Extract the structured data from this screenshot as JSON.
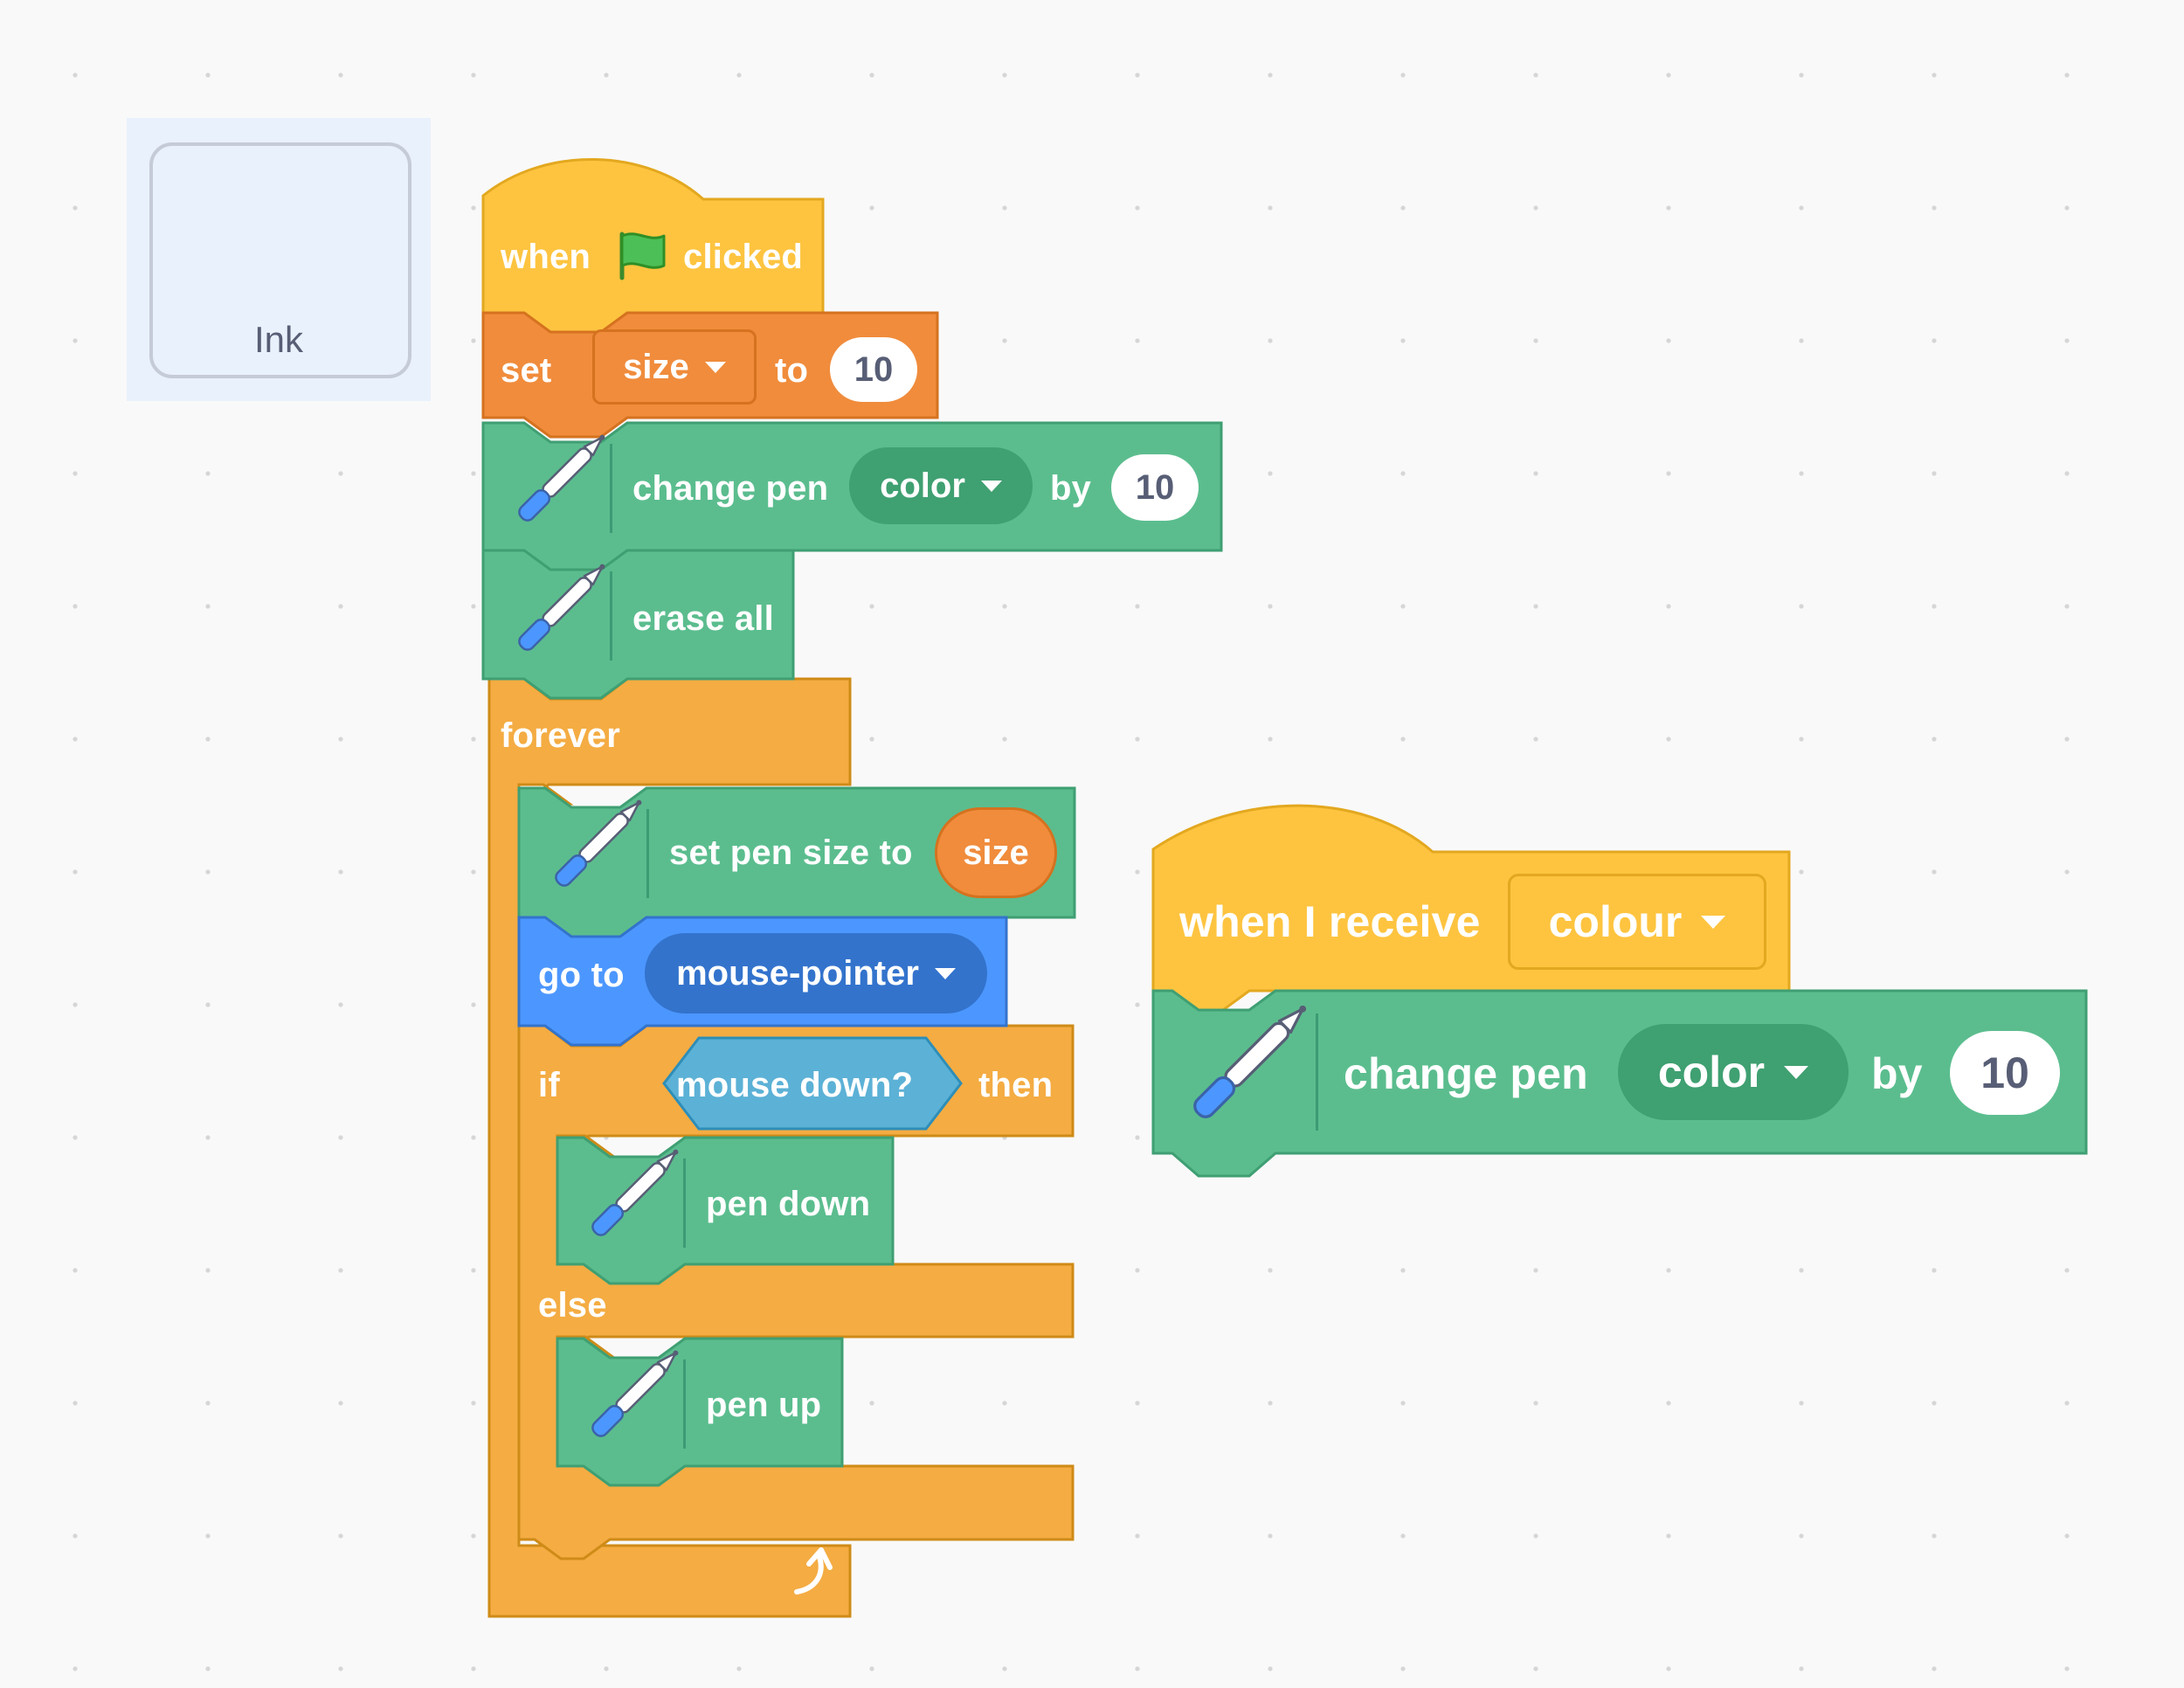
{
  "sprite": {
    "name": "Ink"
  },
  "script_main": {
    "hat": {
      "when": "when",
      "clicked": "clicked",
      "icon": "green-flag-icon"
    },
    "set_var": {
      "set": "set",
      "variable": "size",
      "to": "to",
      "value": "10"
    },
    "change_pen_1": {
      "label": "change pen",
      "param": "color",
      "by": "by",
      "value": "10"
    },
    "erase_all": {
      "label": "erase all"
    },
    "forever": {
      "label": "forever",
      "icon": "loop-arrow-icon"
    },
    "set_pen_size": {
      "label": "set pen size to",
      "reporter": "size"
    },
    "go_to": {
      "label": "go to",
      "target": "mouse-pointer"
    },
    "if_else": {
      "if": "if",
      "condition": "mouse down?",
      "then": "then",
      "else": "else"
    },
    "pen_down": {
      "label": "pen down"
    },
    "pen_up": {
      "label": "pen up"
    }
  },
  "script_receive": {
    "hat": {
      "label": "when I receive",
      "message": "colour"
    },
    "change_pen": {
      "label": "change pen",
      "param": "color",
      "by": "by",
      "value": "10"
    }
  },
  "colors": {
    "events": "#ffbf00",
    "variables": "#ff8c1a",
    "pen": "#0fbd8c",
    "control": "#ffab19",
    "motion": "#4c97ff",
    "sensing": "#5cb1d6",
    "canvas": "#f9f9f9"
  }
}
